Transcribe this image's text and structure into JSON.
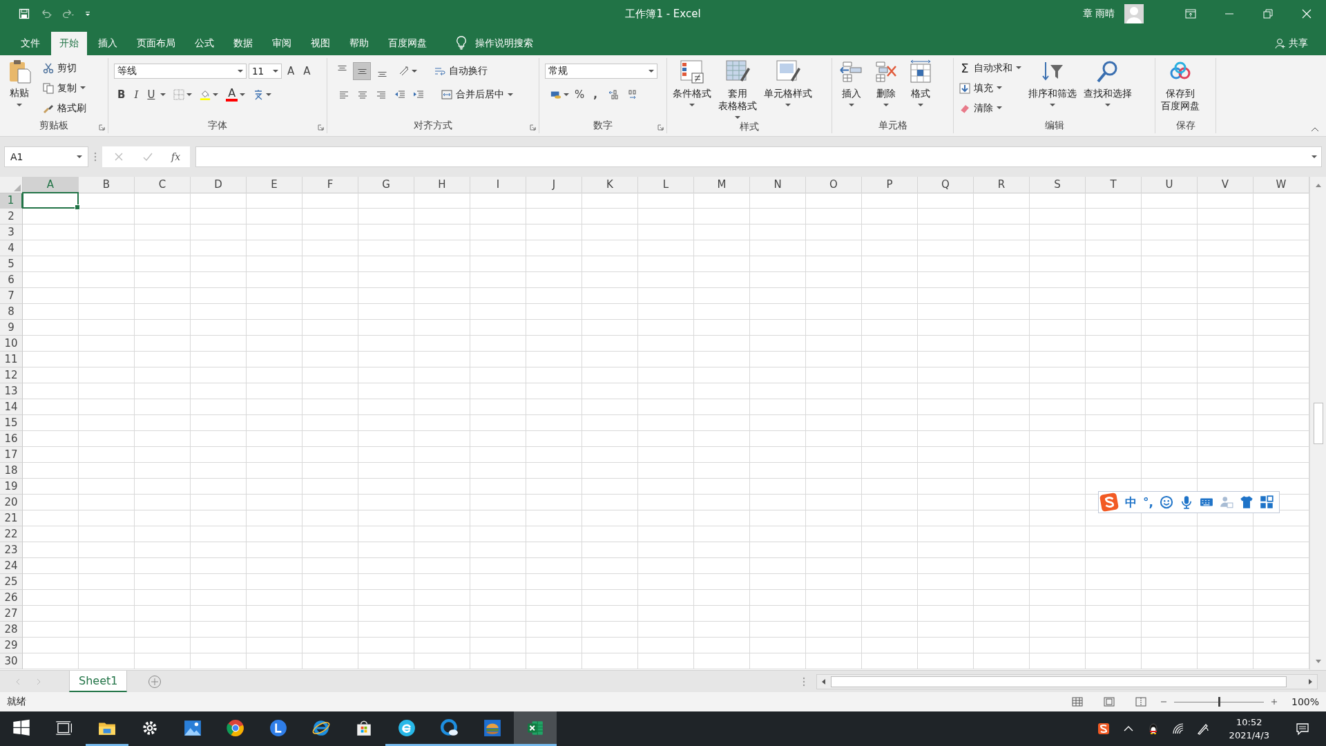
{
  "title_bar": {
    "title": "工作簿1 - Excel",
    "user": "章 雨晴"
  },
  "tabs": [
    {
      "label": "文件",
      "selected": false
    },
    {
      "label": "开始",
      "selected": true
    },
    {
      "label": "插入",
      "selected": false
    },
    {
      "label": "页面布局",
      "selected": false
    },
    {
      "label": "公式",
      "selected": false
    },
    {
      "label": "数据",
      "selected": false
    },
    {
      "label": "审阅",
      "selected": false
    },
    {
      "label": "视图",
      "selected": false
    },
    {
      "label": "帮助",
      "selected": false
    },
    {
      "label": "百度网盘",
      "selected": false
    }
  ],
  "tell_me": "操作说明搜索",
  "share": "共享",
  "ribbon": {
    "clipboard": {
      "label": "剪贴板",
      "paste": "粘贴",
      "commands": [
        "剪切",
        "复制",
        "格式刷"
      ]
    },
    "font": {
      "label": "字体",
      "font_name": "等线",
      "font_size": "11",
      "grow": "A",
      "shrink": "A",
      "bold": "B",
      "italic": "I",
      "underline": "U",
      "font_color": "A"
    },
    "alignment": {
      "label": "对齐方式",
      "vertical": [
        {
          "selected": false
        },
        {
          "selected": true
        },
        {
          "selected": false
        }
      ],
      "wrap": "自动换行",
      "merge": "合并后居中"
    },
    "number": {
      "label": "数字",
      "format": "常规",
      "percent": "%",
      "comma": ","
    },
    "styles": {
      "label": "样式",
      "commands": [
        [
          "条件格式"
        ],
        [
          "套用",
          "表格格式"
        ],
        [
          "单元格样式"
        ]
      ]
    },
    "cells": {
      "label": "单元格",
      "commands": [
        "插入",
        "删除",
        "格式"
      ]
    },
    "editing": {
      "label": "编辑",
      "sum_symbol": "Σ",
      "small": [
        "自动求和",
        "填充",
        "清除"
      ],
      "large": [
        "排序和筛选",
        "查找和选择"
      ]
    },
    "save": {
      "label": "保存",
      "command": [
        "保存到",
        "百度网盘"
      ]
    }
  },
  "formula_bar": {
    "name_box": "A1",
    "function_label": "fx"
  },
  "sheet": {
    "columns": [
      {
        "label": "A",
        "selected": true
      },
      {
        "label": "B",
        "selected": false
      },
      {
        "label": "C",
        "selected": false
      },
      {
        "label": "D",
        "selected": false
      },
      {
        "label": "E",
        "selected": false
      },
      {
        "label": "F",
        "selected": false
      },
      {
        "label": "G",
        "selected": false
      },
      {
        "label": "H",
        "selected": false
      },
      {
        "label": "I",
        "selected": false
      },
      {
        "label": "J",
        "selected": false
      },
      {
        "label": "K",
        "selected": false
      },
      {
        "label": "L",
        "selected": false
      },
      {
        "label": "M",
        "selected": false
      },
      {
        "label": "N",
        "selected": false
      },
      {
        "label": "O",
        "selected": false
      },
      {
        "label": "P",
        "selected": false
      },
      {
        "label": "Q",
        "selected": false
      },
      {
        "label": "R",
        "selected": false
      },
      {
        "label": "S",
        "selected": false
      },
      {
        "label": "T",
        "selected": false
      },
      {
        "label": "U",
        "selected": false
      },
      {
        "label": "V",
        "selected": false
      },
      {
        "label": "W",
        "selected": false
      }
    ],
    "rows": [
      {
        "label": "1",
        "selected": true
      },
      {
        "label": "2",
        "selected": false
      },
      {
        "label": "3",
        "selected": false
      },
      {
        "label": "4",
        "selected": false
      },
      {
        "label": "5",
        "selected": false
      },
      {
        "label": "6",
        "selected": false
      },
      {
        "label": "7",
        "selected": false
      },
      {
        "label": "8",
        "selected": false
      },
      {
        "label": "9",
        "selected": false
      },
      {
        "label": "10",
        "selected": false
      },
      {
        "label": "11",
        "selected": false
      },
      {
        "label": "12",
        "selected": false
      },
      {
        "label": "13",
        "selected": false
      },
      {
        "label": "14",
        "selected": false
      },
      {
        "label": "15",
        "selected": false
      },
      {
        "label": "16",
        "selected": false
      },
      {
        "label": "17",
        "selected": false
      },
      {
        "label": "18",
        "selected": false
      },
      {
        "label": "19",
        "selected": false
      },
      {
        "label": "20",
        "selected": false
      },
      {
        "label": "21",
        "selected": false
      },
      {
        "label": "22",
        "selected": false
      },
      {
        "label": "23",
        "selected": false
      },
      {
        "label": "24",
        "selected": false
      },
      {
        "label": "25",
        "selected": false
      },
      {
        "label": "26",
        "selected": false
      },
      {
        "label": "27",
        "selected": false
      },
      {
        "label": "28",
        "selected": false
      },
      {
        "label": "29",
        "selected": false
      },
      {
        "label": "30",
        "selected": false
      }
    ]
  },
  "ime_toolbar": {
    "mode": "中",
    "punctuation": "°,"
  },
  "sheet_tabs": [
    {
      "label": "Sheet1",
      "selected": true
    }
  ],
  "status_bar": {
    "status": "就绪",
    "zoom_slider": {
      "level": 0.5
    },
    "zoom": "100%"
  },
  "taskbar": {
    "apps": [
      {
        "running": true,
        "selected": false
      },
      {
        "running": false,
        "selected": false
      },
      {
        "running": false,
        "selected": false
      },
      {
        "running": false,
        "selected": false
      },
      {
        "running": false,
        "selected": false
      },
      {
        "running": false,
        "selected": false
      },
      {
        "running": false,
        "selected": false
      },
      {
        "running": true,
        "selected": false
      },
      {
        "running": true,
        "selected": false
      },
      {
        "running": true,
        "selected": false
      },
      {
        "running": true,
        "selected": true
      }
    ],
    "time": "10:52",
    "date": "2021/4/3"
  }
}
